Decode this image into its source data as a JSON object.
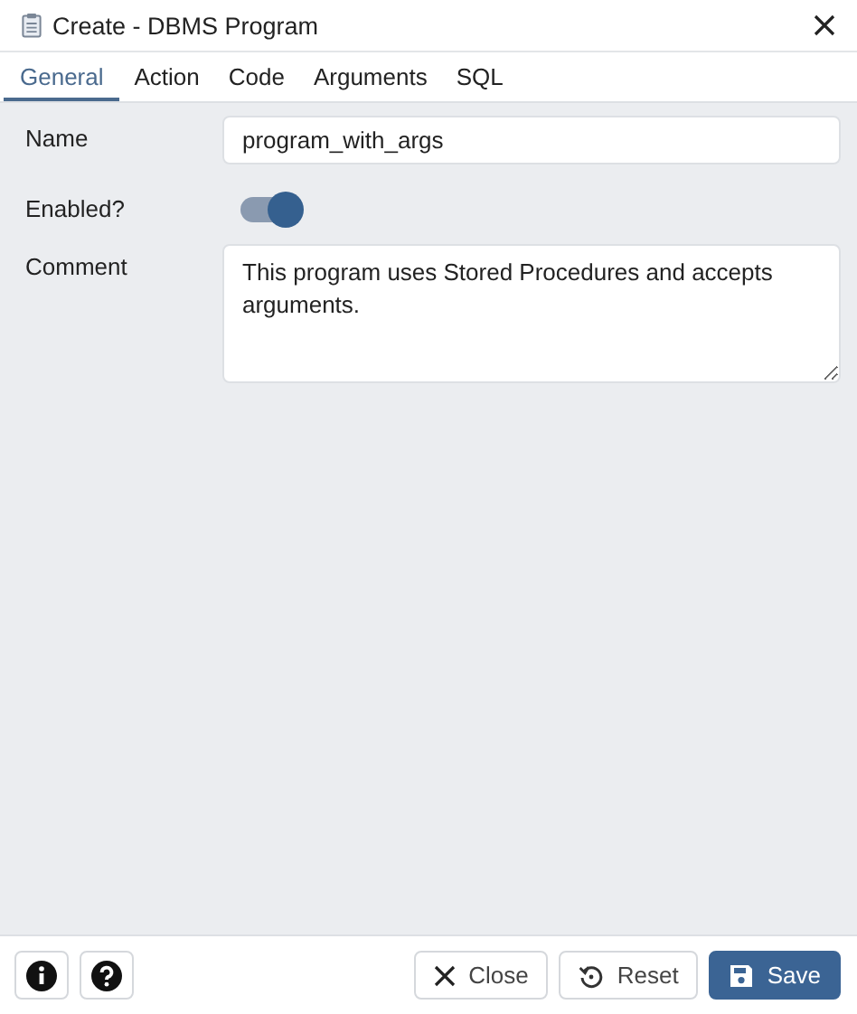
{
  "window": {
    "title": "Create - DBMS Program"
  },
  "tabs": [
    {
      "label": "General",
      "selected": true
    },
    {
      "label": "Action",
      "selected": false
    },
    {
      "label": "Code",
      "selected": false
    },
    {
      "label": "Arguments",
      "selected": false
    },
    {
      "label": "SQL",
      "selected": false
    }
  ],
  "fields": [
    {
      "kind": "text",
      "label": "Name",
      "value": "program_with_args"
    },
    {
      "kind": "switch",
      "label": "Enabled?",
      "on": true
    },
    {
      "kind": "textarea",
      "label": "Comment",
      "value": "This program uses Stored Procedures and accepts arguments."
    }
  ],
  "buttons": [
    {
      "kind": "close",
      "label": "Close"
    },
    {
      "kind": "reset",
      "label": "Reset"
    },
    {
      "kind": "save",
      "label": "Save"
    }
  ]
}
